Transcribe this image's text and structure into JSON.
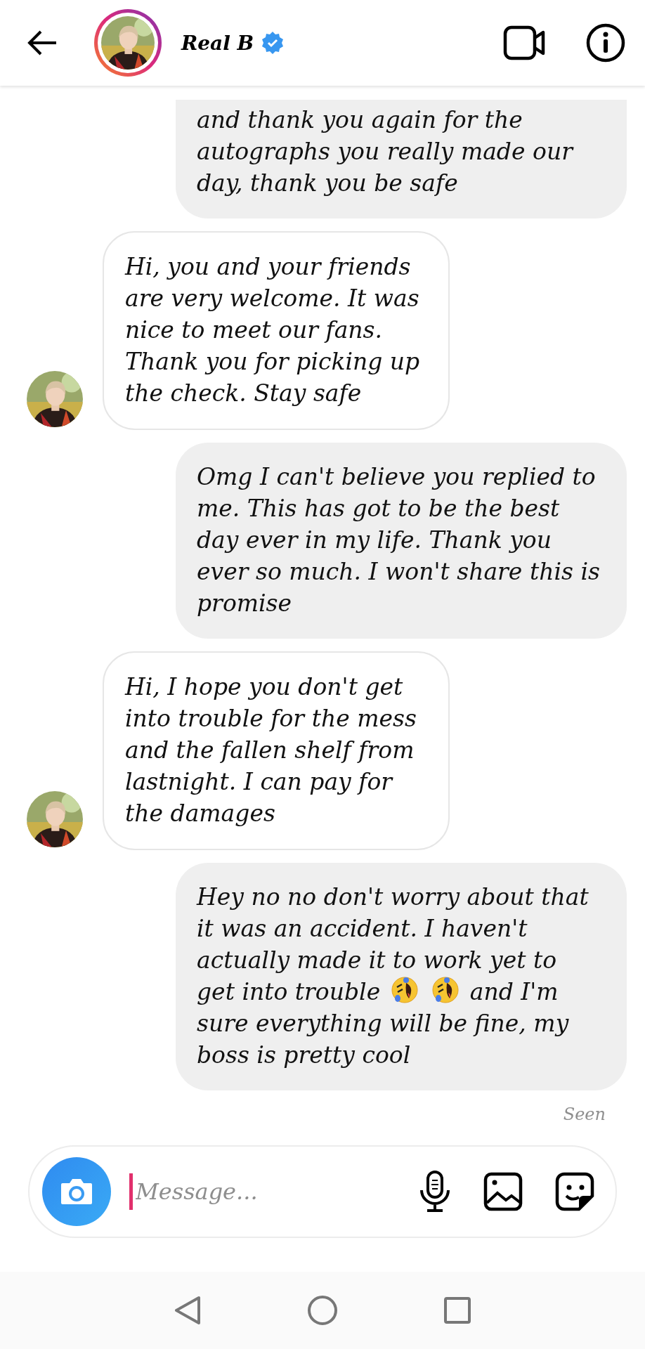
{
  "header": {
    "name": "Real B",
    "verified": true
  },
  "messages": [
    {
      "kind": "sent",
      "parts": [
        {
          "kind": "block",
          "text": "and thank you again for the autographs you really made our day, thank you be safe"
        }
      ]
    },
    {
      "kind": "received",
      "parts": [
        {
          "kind": "block",
          "text": "Hi, you and your friends are very welcome. It was nice to meet our fans. Thank you for picking up the check. Stay safe"
        }
      ]
    },
    {
      "kind": "sent",
      "parts": [
        {
          "kind": "block",
          "text": "Omg I can't believe you replied to me. This has got to be the best day ever in my life. Thank you ever so much. I won't share this is promise"
        }
      ]
    },
    {
      "kind": "received",
      "parts": [
        {
          "kind": "block",
          "text": "Hi, I hope you don't get into trouble for the mess and the fallen shelf from lastnight. I can pay for the damages"
        }
      ]
    },
    {
      "kind": "sent",
      "parts": [
        {
          "kind": "block",
          "text": "Hey no no don't worry about that it was an accident. I haven't actually made it to work yet to"
        },
        {
          "kind": "inline",
          "text": "get into trouble"
        },
        {
          "kind": "emoji"
        },
        {
          "kind": "emoji"
        },
        {
          "kind": "inline",
          "text": "and I'm"
        },
        {
          "kind": "block",
          "text": "sure everything will be fine, my boss is pretty cool"
        }
      ]
    }
  ],
  "status": "Seen",
  "composer": {
    "placeholder": "Message..."
  }
}
